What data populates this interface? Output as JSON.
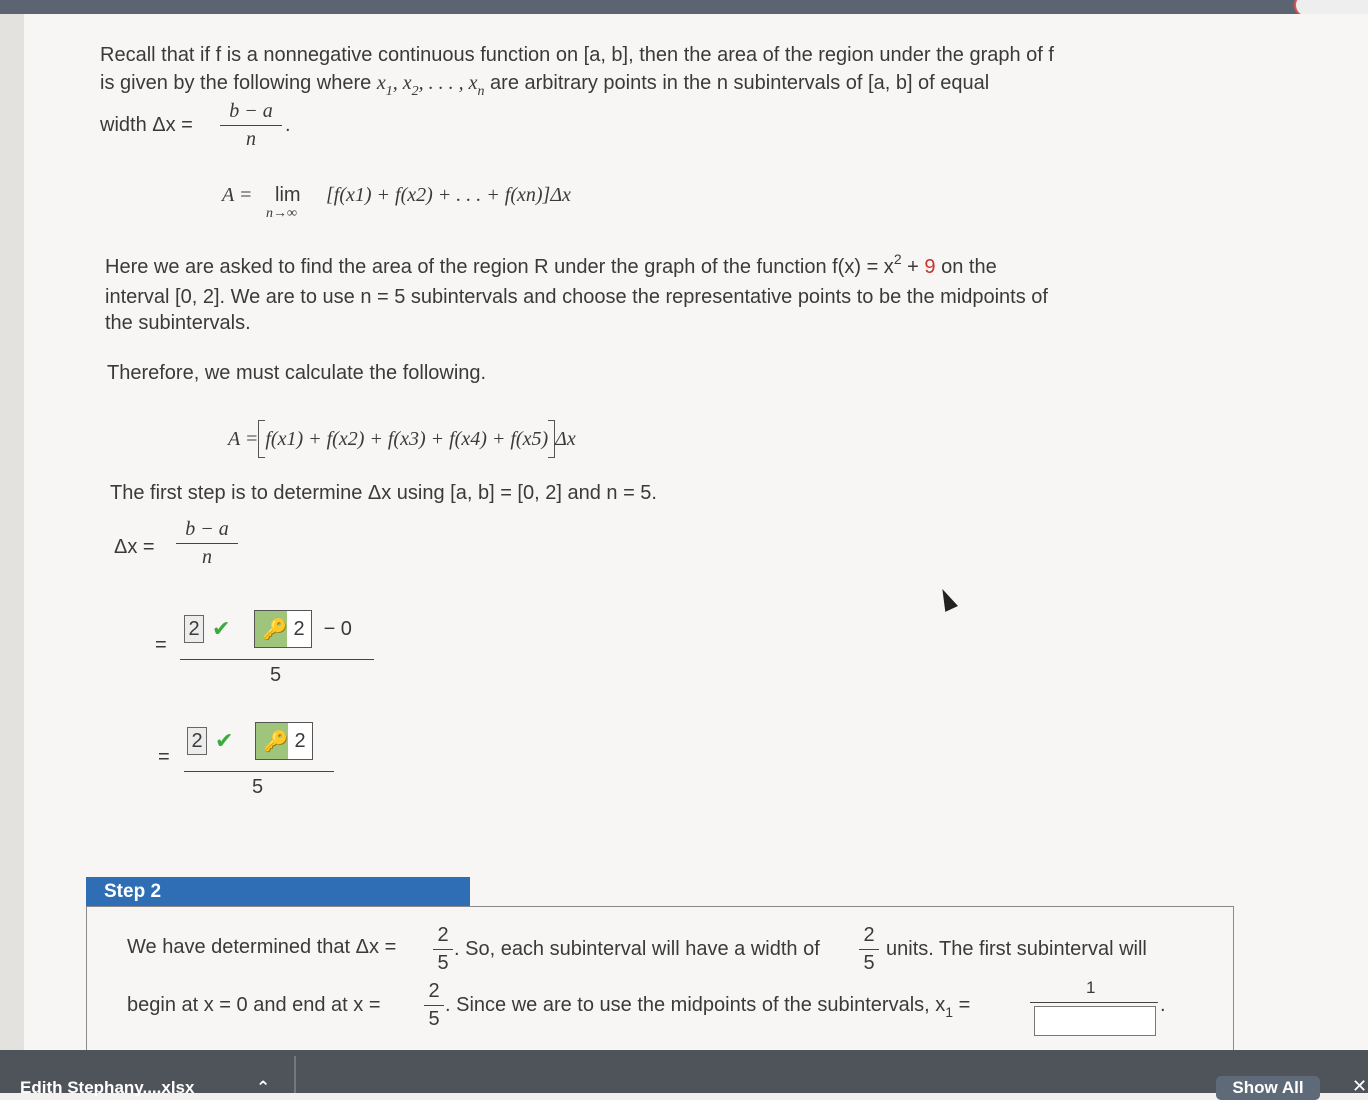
{
  "intro": {
    "line1": "Recall that if f is a nonnegative continuous function on [a, b], then the area of the region under the graph of f",
    "line2_a": "is given by the following where ",
    "line2_vars": "x",
    "line2_b": " are arbitrary points in the n subintervals of [a, b] of equal",
    "width_label": "width Δx = ",
    "frac_num": "b − a",
    "frac_den": "n",
    "formula_lhs": "A = ",
    "formula_lim": "lim",
    "formula_lim_sub": "n→∞",
    "formula_rhs": "[f(x1) + f(x2) + . . . + f(xn)]Δx"
  },
  "problem": {
    "line1_a": "Here we are asked to find the area of the region R under the graph of the function f(x) = x",
    "line1_sup": "2",
    "line1_plus": " + ",
    "line1_red": "9",
    "line1_b": " on the",
    "line2": "interval [0, 2]. We are to use n = 5 subintervals and choose the representative points to be the midpoints of",
    "line3": "the subintervals."
  },
  "therefore": "Therefore, we must calculate the following.",
  "sum_formula": {
    "lhs": "A = ",
    "inside": "f(x1) + f(x2) + f(x3) + f(x4) + f(x5)",
    "rhs": "Δx"
  },
  "first_step": "The first step is to determine Δx using [a, b] = [0, 2] and n = 5.",
  "delta": {
    "lhs": "Δx  =",
    "num": "b − a",
    "den": "n"
  },
  "row1": {
    "eq": "=",
    "answer": "2",
    "key_value": "2",
    "minus": "− 0",
    "den": "5"
  },
  "row2": {
    "eq": "=",
    "answer": "2",
    "key_value": "2",
    "den": "5"
  },
  "step2": {
    "tab_label": "Step 2",
    "l1_a": "We have determined that Δx = ",
    "l1_b": ". So, each subinterval will have a width of ",
    "l1_c": " units. The first subinterval will",
    "l2_a": "begin at x = 0 and end at x = ",
    "l2_b": ". Since we are to use the midpoints of the subintervals, x",
    "l2_sub": "1",
    "l2_eq": " = ",
    "frac_num": "2",
    "frac_den": "5",
    "answer_num": "1"
  },
  "bottombar": {
    "file_label": "Edith Stephany....xlsx",
    "show_all": "Show All"
  },
  "colors": {
    "accent_blue": "#2f6db5",
    "red": "#c8322f",
    "check_green": "#3bab3b",
    "key_green": "#9fc57d"
  },
  "icons": [
    "check-icon",
    "key-icon",
    "chevron-up-icon",
    "close-icon",
    "mouse-cursor-icon"
  ]
}
